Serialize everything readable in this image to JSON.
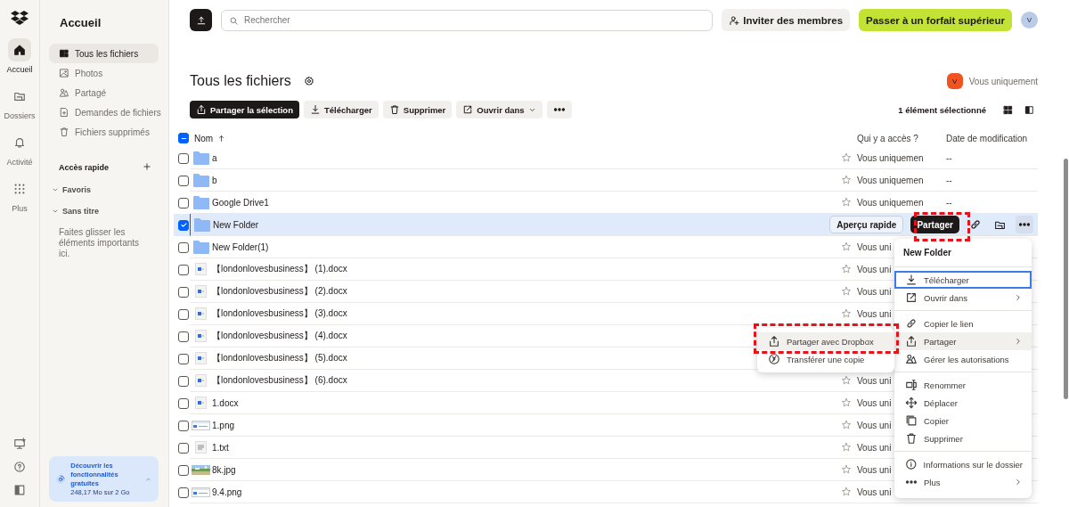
{
  "rail": {
    "items": [
      {
        "label": "Accueil",
        "selected": true
      },
      {
        "label": "Dossiers",
        "selected": false
      },
      {
        "label": "Activité",
        "selected": false
      },
      {
        "label": "Plus",
        "selected": false
      }
    ]
  },
  "sidebar": {
    "title": "Accueil",
    "items": [
      {
        "label": "Tous les fichiers",
        "selected": true
      },
      {
        "label": "Photos",
        "selected": false
      },
      {
        "label": "Partagé",
        "selected": false
      },
      {
        "label": "Demandes de fichiers",
        "selected": false
      },
      {
        "label": "Fichiers supprimés",
        "selected": false
      }
    ],
    "quick_access": {
      "title": "Accès rapide",
      "groups": [
        {
          "label": "Favoris",
          "expanded": true
        },
        {
          "label": "Sans titre",
          "expanded": true
        }
      ],
      "hint": "Faites glisser les éléments importants ici."
    },
    "promo": {
      "title": "Découvrir les fonctionnalités gratuites",
      "usage": "248,17 Mo sur 2  Go"
    }
  },
  "topbar": {
    "search": {
      "placeholder": "Rechercher"
    },
    "invite": "Inviter des membres",
    "upgrade": "Passer à un forfait supérieur",
    "avatar": "V"
  },
  "header": {
    "title": "Tous les fichiers",
    "owner_avatar": "V",
    "owner": "Vous uniquement"
  },
  "toolbar": {
    "buttons": [
      {
        "label": "Partager la sélection",
        "kind": "primary"
      },
      {
        "label": "Télécharger",
        "kind": "download"
      },
      {
        "label": "Supprimer",
        "kind": "delete"
      },
      {
        "label": "Ouvrir dans",
        "kind": "open"
      }
    ],
    "selection": "1 élément sélectionné"
  },
  "table": {
    "columns": [
      "Nom",
      "Qui y a accès ?",
      "Date de modification"
    ],
    "some_selected": true,
    "quick_actions": {
      "preview": "Aperçu rapide",
      "share": "Partager"
    },
    "rows": [
      {
        "name": "a",
        "kind": "folder",
        "selected": false,
        "access": "Vous uniquemen",
        "date": "--"
      },
      {
        "name": "b",
        "kind": "folder",
        "selected": false,
        "access": "Vous uniquemen",
        "date": "--"
      },
      {
        "name": "Google Drive1",
        "kind": "folder",
        "selected": false,
        "access": "Vous uniquemen",
        "date": "--"
      },
      {
        "name": "New Folder",
        "kind": "folder",
        "selected": true
      },
      {
        "name": "New Folder(1)",
        "kind": "folder",
        "selected": false,
        "access": "Vous uni"
      },
      {
        "name": "【londonlovesbusiness】 (1).docx",
        "kind": "doc",
        "selected": false,
        "access": "Vous uni"
      },
      {
        "name": "【londonlovesbusiness】 (2).docx",
        "kind": "doc",
        "selected": false,
        "access": "Vous uni"
      },
      {
        "name": "【londonlovesbusiness】 (3).docx",
        "kind": "doc",
        "selected": false,
        "access": "Vous uni"
      },
      {
        "name": "【londonlovesbusiness】 (4).docx",
        "kind": "doc",
        "selected": false
      },
      {
        "name": "【londonlovesbusiness】 (5).docx",
        "kind": "doc",
        "selected": false
      },
      {
        "name": "【londonlovesbusiness】 (6).docx",
        "kind": "doc",
        "selected": false,
        "access": "Vous uni"
      },
      {
        "name": "1.docx",
        "kind": "doc",
        "selected": false,
        "access": "Vous uni"
      },
      {
        "name": "1.png",
        "kind": "screenshot",
        "selected": false,
        "access": "Vous uni"
      },
      {
        "name": "1.txt",
        "kind": "text",
        "selected": false,
        "access": "Vous uni"
      },
      {
        "name": "8k.jpg",
        "selected": false,
        "access": "Vous uni"
      },
      {
        "name": "9.4.png",
        "kind": "screenshot",
        "selected": false,
        "access": "Vous uni"
      }
    ]
  },
  "context_menu": {
    "title": "New Folder",
    "sections": [
      [
        {
          "label": "Télécharger",
          "focused": true,
          "highlighted": false,
          "has_submenu": false
        },
        {
          "label": "Ouvrir dans",
          "focused": false,
          "highlighted": false,
          "has_submenu": true
        }
      ],
      [
        {
          "label": "Copier le lien",
          "focused": false,
          "highlighted": false,
          "has_submenu": false
        },
        {
          "label": "Partager",
          "focused": false,
          "highlighted": true,
          "has_submenu": true
        },
        {
          "label": "Gérer les autorisations",
          "focused": false,
          "highlighted": false,
          "has_submenu": false
        }
      ],
      [
        {
          "label": "Renommer",
          "focused": false,
          "highlighted": false,
          "has_submenu": false
        },
        {
          "label": "Déplacer",
          "focused": false,
          "highlighted": false,
          "has_submenu": false
        },
        {
          "label": "Copier",
          "focused": false,
          "highlighted": false,
          "has_submenu": false
        },
        {
          "label": "Supprimer",
          "focused": false,
          "highlighted": false,
          "has_submenu": false
        }
      ],
      [
        {
          "label": "Informations sur le dossier",
          "focused": false,
          "highlighted": false,
          "has_submenu": false
        },
        {
          "label": "Plus",
          "focused": false,
          "highlighted": false,
          "has_submenu": true
        }
      ]
    ]
  },
  "submenu": {
    "items": [
      {
        "label": "Partager avec Dropbox",
        "highlighted": true
      },
      {
        "label": "Transférer une copie",
        "highlighted": false
      }
    ]
  }
}
